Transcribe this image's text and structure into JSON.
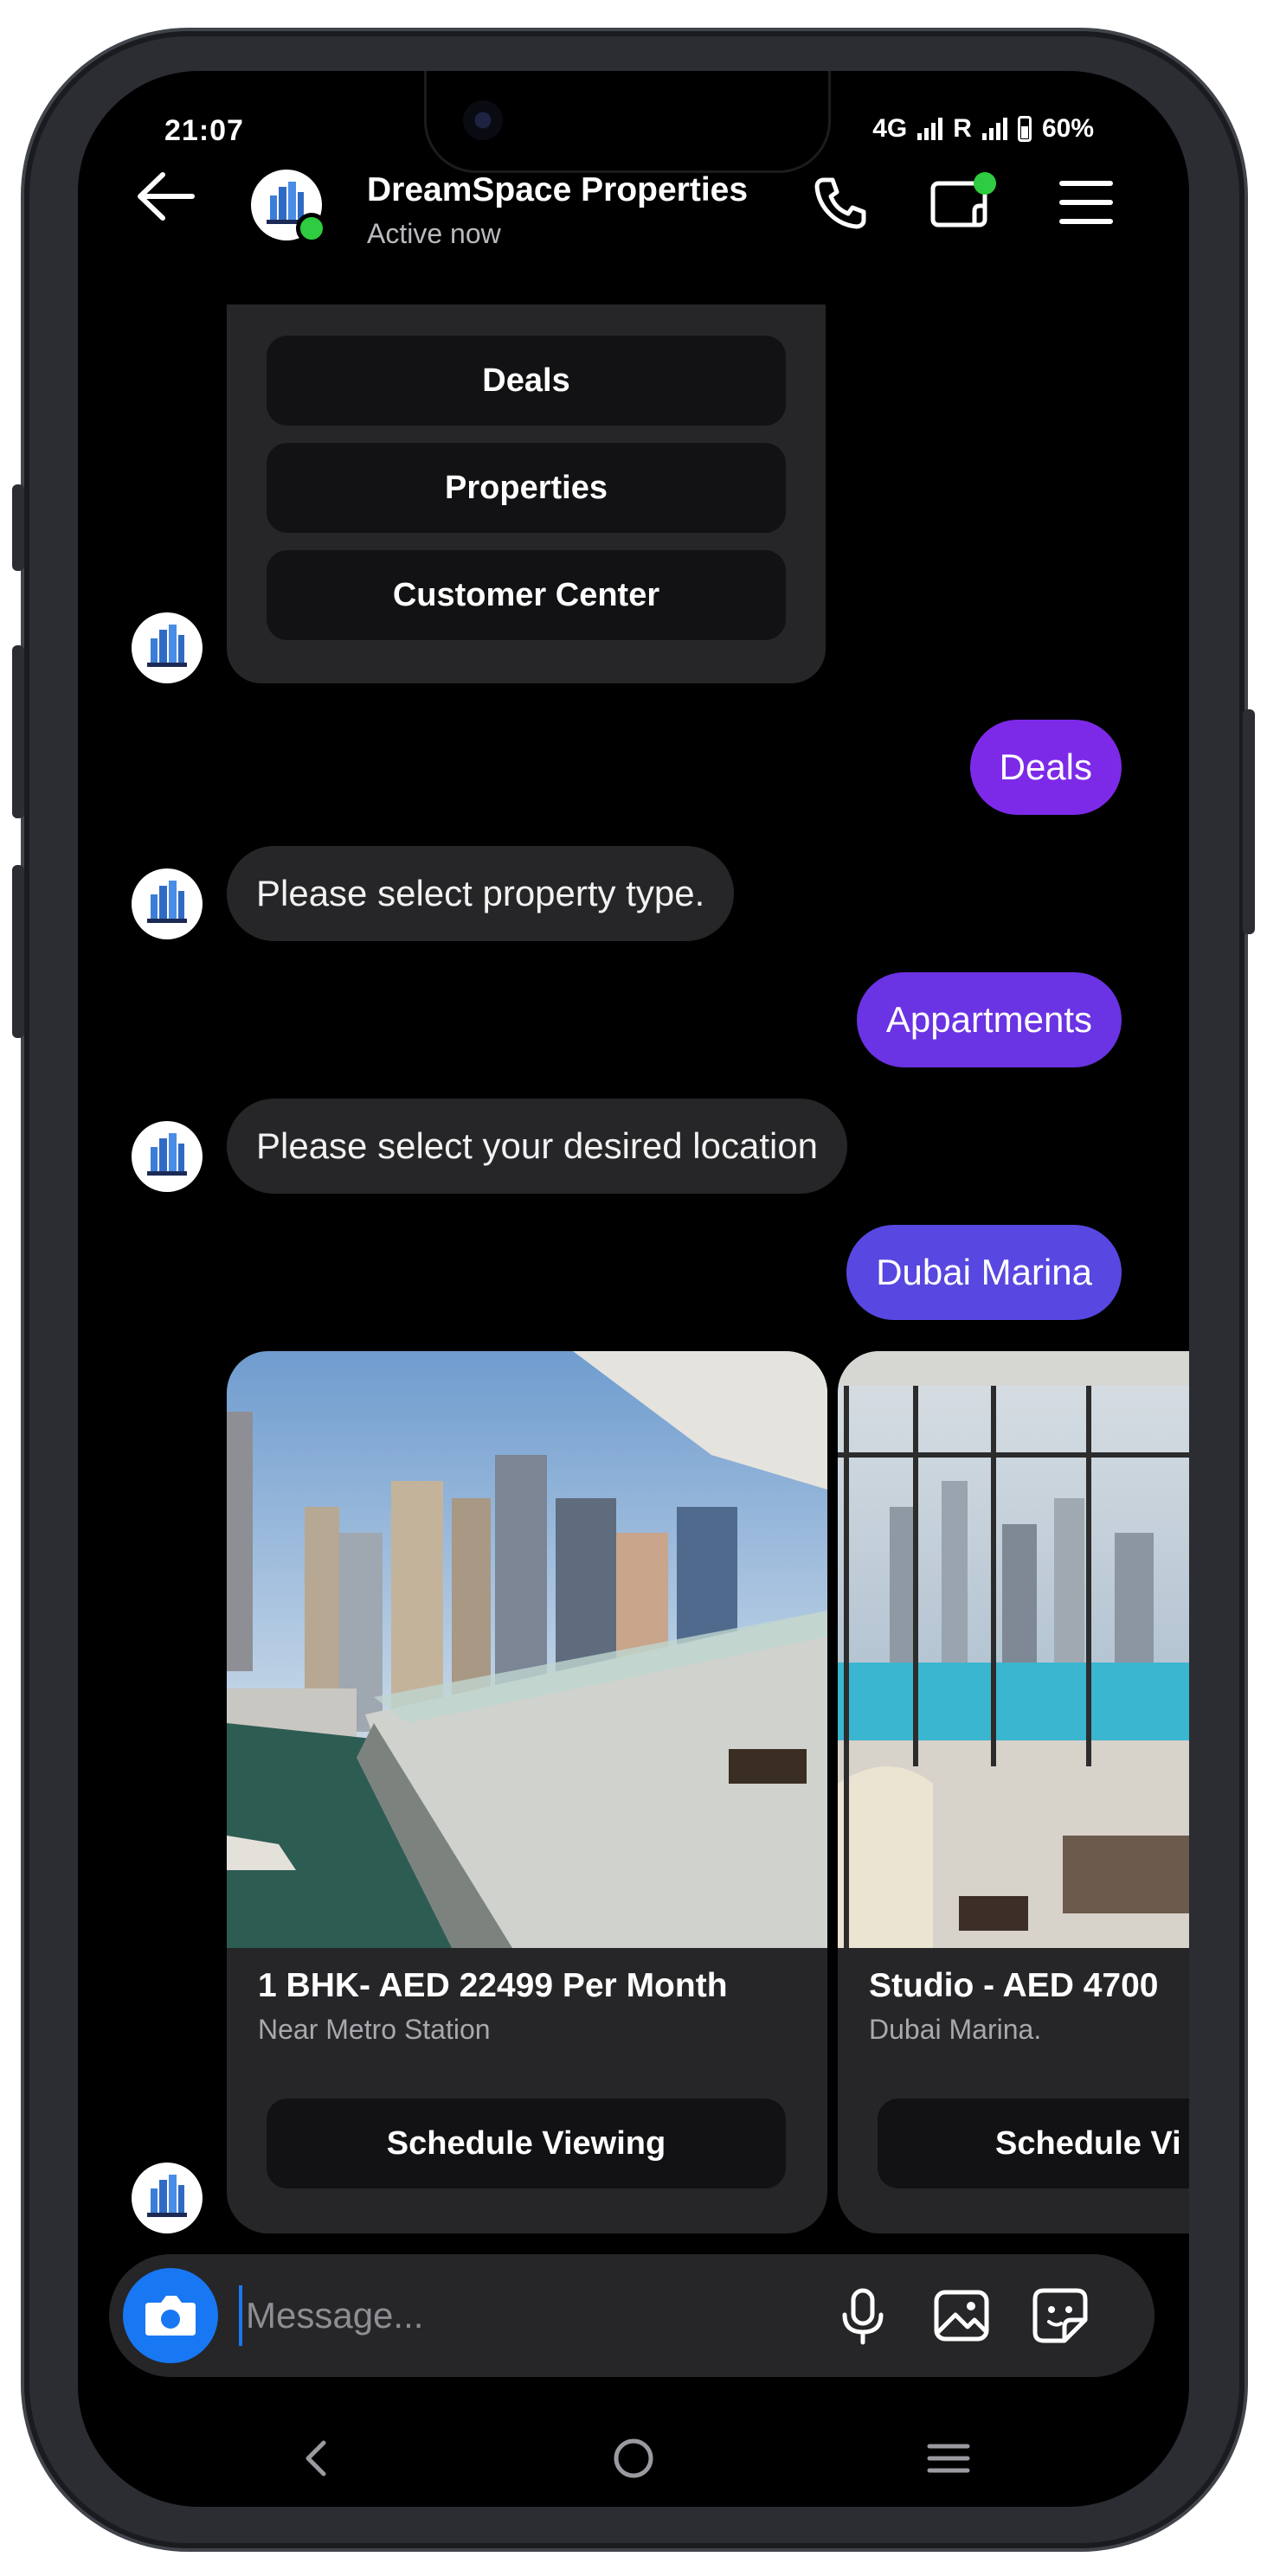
{
  "status_bar": {
    "time": "21:07",
    "network1": "4G",
    "roaming": "R",
    "battery": "60%"
  },
  "header": {
    "title": "DreamSpace Properties",
    "status": "Active now"
  },
  "menu": {
    "options": [
      "Deals",
      "Properties",
      "Customer Center"
    ]
  },
  "messages": {
    "out_1": "Deals",
    "in_1": "Please select property type.",
    "out_2": "Appartments",
    "in_2": "Please select your desired location",
    "out_3": "Dubai Marina"
  },
  "cards": [
    {
      "title": "1 BHK- AED 22499 Per Month",
      "subtitle": "Near Metro Station",
      "button": "Schedule Viewing"
    },
    {
      "title": "Studio - AED 4700",
      "subtitle": "Dubai Marina.",
      "button": "Schedule Vi"
    }
  ],
  "composer": {
    "placeholder": "Message..."
  },
  "colors": {
    "bubble_deals": "#7d2ae8",
    "bubble_appartments": "#6a33e3",
    "bubble_dubai": "#5847e0",
    "accent_blue": "#1877f2",
    "online_green": "#2ecc40"
  }
}
